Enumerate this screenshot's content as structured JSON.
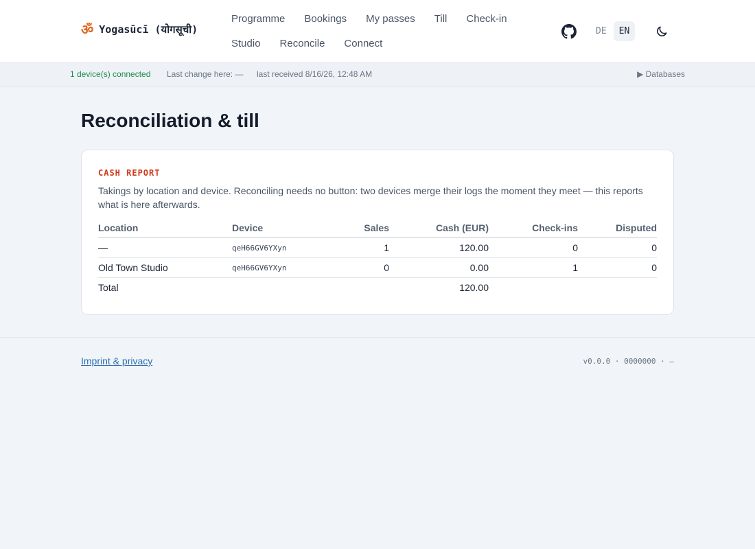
{
  "header": {
    "logo_glyph": "ॐ",
    "brand": "Yogasūcī (योगसूची)",
    "nav": [
      "Programme",
      "Bookings",
      "My passes",
      "Till",
      "Check-in",
      "Studio",
      "Reconcile",
      "Connect"
    ],
    "lang": [
      "DE",
      "EN"
    ],
    "lang_active": "EN",
    "github_icon": "github-icon",
    "theme_icon": "moon-icon"
  },
  "status": {
    "connected": "1 device(s) connected",
    "last_change": "Last change here: —",
    "last_received": "last received 8/16/26, 12:48 AM",
    "databases": "▶ Databases"
  },
  "main": {
    "title": "Reconciliation & till",
    "card": {
      "kicker": "CASH REPORT",
      "description": "Takings by location and device. Reconciling needs no button: two devices merge their logs the moment they meet — this reports what is here afterwards.",
      "columns": [
        "Location",
        "Device",
        "Sales",
        "Cash (EUR)",
        "Check-ins",
        "Disputed"
      ],
      "rows": [
        {
          "location": "—",
          "device": "qeH66GV6YXyn",
          "sales": "1",
          "cash": "120.00",
          "checkins": "0",
          "disputed": "0"
        },
        {
          "location": "Old Town Studio",
          "device": "qeH66GV6YXyn",
          "sales": "0",
          "cash": "0.00",
          "checkins": "1",
          "disputed": "0"
        }
      ],
      "total": {
        "label": "Total",
        "cash": "120.00"
      }
    }
  },
  "footer": {
    "imprint": "Imprint & privacy",
    "version": "v0.0.0 · 0000000 · —"
  },
  "colors": {
    "accent": "#d03a1c",
    "connected": "#1f8a4c",
    "link": "#2a6fb0"
  }
}
